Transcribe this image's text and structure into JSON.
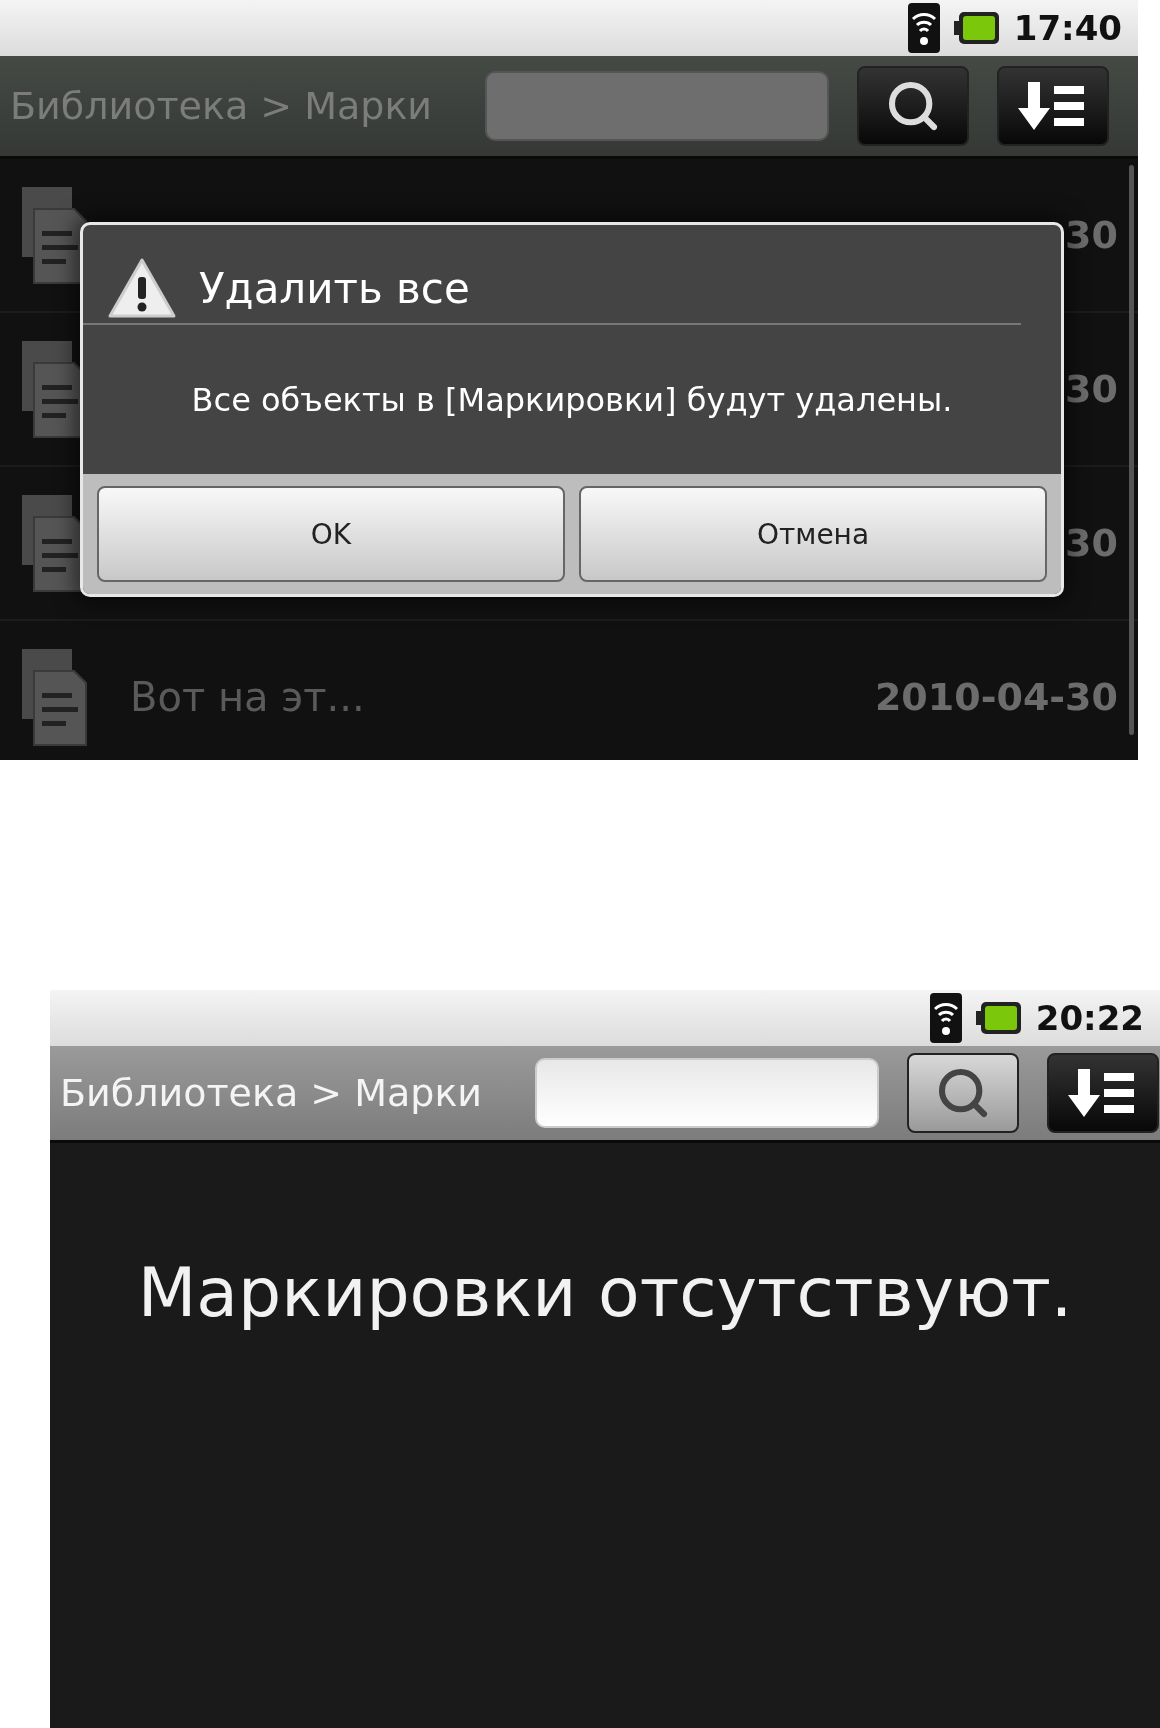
{
  "screens": [
    {
      "status_bar": {
        "time": "17:40"
      },
      "title_bar": {
        "breadcrumb": "Библиотека > Марки",
        "dimmed": true
      },
      "list": [
        {
          "date": "30"
        },
        {
          "date": "30"
        },
        {
          "date": "30"
        },
        {
          "title": "Вот на эт...",
          "date": "2010-04-30"
        }
      ],
      "dialog": {
        "title": "Удалить все",
        "message": "Все объекты в [Маркировки] будут удалены.",
        "buttons": [
          "OK",
          "Отмена"
        ]
      }
    },
    {
      "status_bar": {
        "time": "20:22"
      },
      "title_bar": {
        "breadcrumb": "Библиотека > Марки",
        "dimmed": false
      },
      "empty_message": "Маркировки отсутствуют."
    }
  ]
}
